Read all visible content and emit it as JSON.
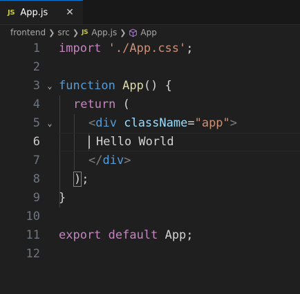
{
  "tab": {
    "icon_label": "JS",
    "label": "App.js",
    "close": "✕"
  },
  "breadcrumb": {
    "items": [
      "frontend",
      "src",
      "App.js",
      "App"
    ],
    "js_icon_label": "JS",
    "icons": [
      "chevron-right-icon",
      "js-file-icon",
      "symbol-cube-icon"
    ]
  },
  "editor": {
    "active_line": 6,
    "line_numbers": [
      "1",
      "2",
      "3",
      "4",
      "5",
      "6",
      "7",
      "8",
      "9",
      "10",
      "11",
      "12"
    ],
    "lines": {
      "l1": {
        "kw": "import",
        "sp": " ",
        "str": "'./App.css'",
        "end": ";"
      },
      "l3": {
        "kw": "function",
        "sp": " ",
        "fn": "App",
        "rest": "() {"
      },
      "l4": {
        "kw": "return",
        "rest": " ("
      },
      "l5": {
        "open": "<",
        "tag": "div",
        "sp": " ",
        "attr": "className",
        "eq": "=",
        "str": "\"app\"",
        "close": ">"
      },
      "l6": {
        "text": "Hello World"
      },
      "l7": {
        "open": "</",
        "tag": "div",
        "close": ">"
      },
      "l8": {
        "paren": ")",
        "end": ";"
      },
      "l9": {
        "brace": "}"
      },
      "l11": {
        "kw": "export",
        "sp": " ",
        "kw2": "default",
        "sp2": " ",
        "name": "App",
        "end": ";"
      }
    }
  },
  "colors": {
    "background": "#1f1f1f",
    "keyword": "#569cd6",
    "control_keyword": "#c586c0",
    "string": "#ce9178",
    "function": "#dcdcaa",
    "attribute": "#9cdcfe",
    "tab_accent": "#0078d4",
    "js_icon": "#cbcb41"
  }
}
